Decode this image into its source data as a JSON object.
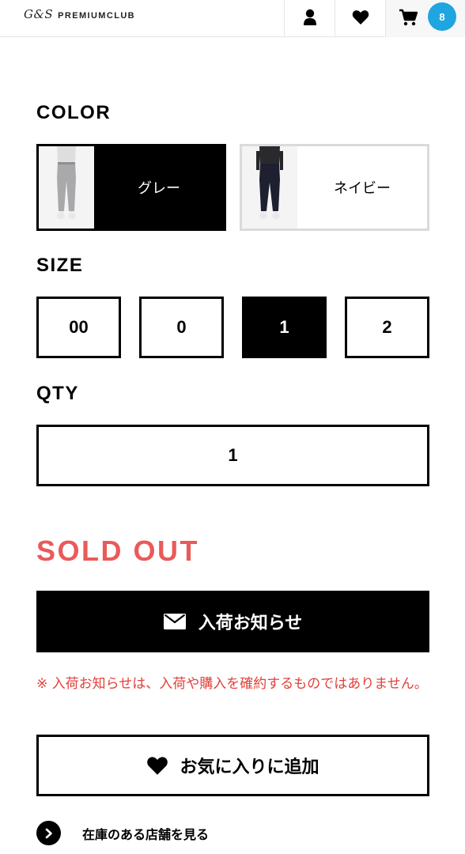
{
  "header": {
    "logo_mark": "G&S",
    "logo_text": "PREMIUMCLUB",
    "icons": {
      "user": "user-icon",
      "favorite": "heart-icon",
      "cart": "cart-icon"
    },
    "cart_count": "8",
    "badge_color": "#1fa5e0"
  },
  "color": {
    "label": "COLOR",
    "options": [
      {
        "name": "グレー",
        "selected": true
      },
      {
        "name": "ネイビー",
        "selected": false
      }
    ]
  },
  "size": {
    "label": "SIZE",
    "options": [
      {
        "name": "00",
        "selected": false
      },
      {
        "name": "0",
        "selected": false
      },
      {
        "name": "1",
        "selected": true
      },
      {
        "name": "2",
        "selected": false
      }
    ]
  },
  "qty": {
    "label": "QTY",
    "value": "1"
  },
  "status": {
    "sold_out": "SOLD OUT",
    "sold_out_color": "#ea5a5a"
  },
  "notify_button": {
    "label": "入荷お知らせ",
    "icon": "mail-icon"
  },
  "notice": {
    "text": "※ 入荷お知らせは、入荷や購入を確約するものではありません。",
    "color": "#e3403a"
  },
  "favorite_button": {
    "label": "お気に入りに追加",
    "icon": "heart-icon"
  },
  "store_link": {
    "label": "在庫のある店舗を見る",
    "icon": "chevron-right-icon"
  }
}
